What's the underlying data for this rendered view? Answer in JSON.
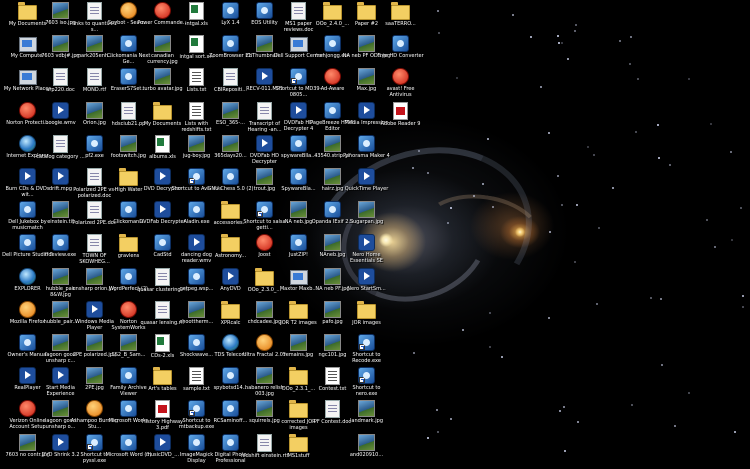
{
  "desktop": {
    "wallpaper": "galaxy",
    "icon_grid": {
      "columns": [
        {
          "icons": [
            {
              "label": "My Documents",
              "icon": "folder-icon"
            },
            {
              "label": "My Computer",
              "icon": "computer-icon"
            },
            {
              "label": "My Network Places",
              "icon": "network-icon"
            },
            {
              "label": "Norton Protecti...",
              "icon": "norton-icon"
            },
            {
              "label": "Internet Explorer",
              "icon": "ie-icon"
            },
            {
              "label": "Burn CDs & DVDs wit...",
              "icon": "cd-icon"
            },
            {
              "label": "Dell Jukebox by musicmatch",
              "icon": "jukebox-icon"
            },
            {
              "label": "Dell Picture Studio 3",
              "icon": "picture-studio-icon"
            },
            {
              "label": "EXPLORER",
              "icon": "explorer-icon"
            },
            {
              "label": "Mozilla Firefox",
              "icon": "firefox-icon"
            },
            {
              "label": "Owner's Manual",
              "icon": "manual-icon"
            },
            {
              "label": "RealPlayer",
              "icon": "realplayer-icon"
            },
            {
              "label": "Verizon Online Account Setup",
              "icon": "verizon-icon"
            },
            {
              "label": "7603 no contr.jpg",
              "icon": "jpg-file-icon"
            }
          ]
        },
        {
          "icons": [
            {
              "label": "7603 iso.jpg",
              "icon": "jpg-file-icon"
            },
            {
              "label": "7603 vdbj#.jpg",
              "icon": "jpg-file-icon"
            },
            {
              "label": "arp220.doc",
              "icon": "doc-file-icon"
            },
            {
              "label": "boogie.wmv",
              "icon": "video-file-icon"
            },
            {
              "label": "catalog category ...",
              "icon": "doc-file-icon"
            },
            {
              "label": "drift.mpg",
              "icon": "video-file-icon"
            },
            {
              "label": "einstein.tif",
              "icon": "image-file-icon"
            },
            {
              "label": "ffdeview.exe",
              "icon": "exe-file-icon"
            },
            {
              "label": "hubble_pair 8&W.jpg",
              "icon": "jpg-file-icon"
            },
            {
              "label": "hubble_pair...",
              "icon": "jpg-file-icon"
            },
            {
              "label": "lagoon good unsharp c...",
              "icon": "jpg-file-icon"
            },
            {
              "label": "Start Media Experience",
              "icon": "media-icon"
            },
            {
              "label": "lagoon good unsharp o...",
              "icon": "jpg-file-icon"
            },
            {
              "label": "DVD Shrink 3.2",
              "icon": "dvd-shrink-icon"
            }
          ]
        },
        {
          "icons": [
            {
              "label": "links to quantized s...",
              "icon": "doc-file-icon"
            },
            {
              "label": "mark205enh...",
              "icon": "jpg-file-icon"
            },
            {
              "label": "MOND.rtf",
              "icon": "doc-file-icon"
            },
            {
              "label": "Orion.jpg",
              "icon": "jpg-file-icon"
            },
            {
              "label": "pf2.exe",
              "icon": "exe-file-icon"
            },
            {
              "label": "Polarized 2PE vs-polarized.doc",
              "icon": "doc-file-icon"
            },
            {
              "label": "Polarized 2PE.doc",
              "icon": "doc-file-icon"
            },
            {
              "label": "TOWN OF SKOWHEG...",
              "icon": "doc-file-icon"
            },
            {
              "label": "unsharp orion.jpg",
              "icon": "jpg-file-icon"
            },
            {
              "label": "Windows Media Player",
              "icon": "wmp-icon"
            },
            {
              "label": "2PE polarized.jpg",
              "icon": "jpg-file-icon"
            },
            {
              "label": "2PE.jpg",
              "icon": "jpg-file-icon"
            },
            {
              "label": "Ashampoo Burning Stu...",
              "icon": "ashampoo-icon"
            },
            {
              "label": "Shortcut to pyssl.exe",
              "icon": "shortcut-icon"
            }
          ]
        },
        {
          "icons": [
            {
              "label": "Spybot - Searc...",
              "icon": "spybot-icon"
            },
            {
              "label": "Clickomania Next Ge...",
              "icon": "game-icon"
            },
            {
              "label": "EraserS7Set...",
              "icon": "exe-file-icon"
            },
            {
              "label": "hdsciub21.pp",
              "icon": "doc-file-icon"
            },
            {
              "label": "footswitch.jpg",
              "icon": "jpg-file-icon"
            },
            {
              "label": "High Water",
              "icon": "folder-icon"
            },
            {
              "label": "Clickomania",
              "icon": "game-icon"
            },
            {
              "label": "gravlens",
              "icon": "folder-icon"
            },
            {
              "label": "WordPerfect (2)",
              "icon": "wordperfect-icon"
            },
            {
              "label": "Norton SystemWorks",
              "icon": "norton-icon"
            },
            {
              "label": "SS2_B_Sam...",
              "icon": "jpg-file-icon"
            },
            {
              "label": "Family Archive Viewer",
              "icon": "app-icon"
            },
            {
              "label": "Microsoft Works",
              "icon": "works-icon"
            },
            {
              "label": "Microsoft Word (2)",
              "icon": "word-icon"
            }
          ]
        },
        {
          "icons": [
            {
              "label": "Power Commande...",
              "icon": "power-icon"
            },
            {
              "label": "canadian currency.jpg",
              "icon": "jpg-file-icon"
            },
            {
              "label": "turbo avatar.jpg",
              "icon": "jpg-file-icon"
            },
            {
              "label": "My Documents",
              "icon": "folder-icon"
            },
            {
              "label": "albums.xls",
              "icon": "xls-file-icon"
            },
            {
              "label": "DVD Decrypter",
              "icon": "dvd-icon"
            },
            {
              "label": "DVDFab Decrypter",
              "icon": "dvd-icon"
            },
            {
              "label": "CadStd",
              "icon": "app-icon"
            },
            {
              "label": "quasar clustering.rtf",
              "icon": "doc-file-icon"
            },
            {
              "label": "quasar lensing.rtf",
              "icon": "doc-file-icon"
            },
            {
              "label": "CDs-2.xls",
              "icon": "xls-file-icon"
            },
            {
              "label": "Art's tables",
              "icon": "folder-icon"
            },
            {
              "label": "History Highway 3.pdf",
              "icon": "pdf-file-icon"
            },
            {
              "label": "musicDVD_...",
              "icon": "media-icon"
            }
          ]
        },
        {
          "icons": [
            {
              "label": "intgal.xls",
              "icon": "xls-file-icon"
            },
            {
              "label": "intgal sort.xls",
              "icon": "xls-file-icon"
            },
            {
              "label": "Lists.txt",
              "icon": "txt-file-icon"
            },
            {
              "label": "Lists with redshifts.txt",
              "icon": "txt-file-icon"
            },
            {
              "label": "jug-boy.jpg",
              "icon": "jpg-file-icon"
            },
            {
              "label": "Shortcut to Avis.exe",
              "icon": "shortcut-icon"
            },
            {
              "label": "Aladin.exe",
              "icon": "exe-file-icon"
            },
            {
              "label": "dancing dog reader.wmv",
              "icon": "video-file-icon"
            },
            {
              "label": "getpeg.wsp...",
              "icon": "exe-file-icon"
            },
            {
              "label": "shoottherm...",
              "icon": "jpg-file-icon"
            },
            {
              "label": "Shockwave...",
              "icon": "app-icon"
            },
            {
              "label": "sample.txt",
              "icon": "txt-file-icon"
            },
            {
              "label": "Shortcut to mtbackup.exe",
              "icon": "shortcut-icon"
            },
            {
              "label": "ImageMagick Display",
              "icon": "imagemagick-icon"
            }
          ]
        },
        {
          "icons": [
            {
              "label": "LyX 1.4",
              "icon": "lyx-icon"
            },
            {
              "label": "ZoomBrowser EX",
              "icon": "camera-icon"
            },
            {
              "label": "CBIRepositi...",
              "icon": "doc-file-icon"
            },
            {
              "label": "ESO_365-...",
              "icon": "jpg-file-icon"
            },
            {
              "label": "365days20...",
              "icon": "jpg-file-icon"
            },
            {
              "label": "GNU Chess 5.0 (2)",
              "icon": "chess-icon"
            },
            {
              "label": "accessories...",
              "icon": "folder-icon"
            },
            {
              "label": "Astronomy...",
              "icon": "folder-icon"
            },
            {
              "label": "AnyDVD",
              "icon": "dvd-icon"
            },
            {
              "label": "XPRcalc",
              "icon": "folder-icon"
            },
            {
              "label": "TDS Telecom",
              "icon": "globe-icon"
            },
            {
              "label": "spybotsd14...",
              "icon": "exe-file-icon"
            },
            {
              "label": "RCSaminoff...",
              "icon": "exe-file-icon"
            },
            {
              "label": "Digital Photo Professional",
              "icon": "camera-icon"
            }
          ]
        },
        {
          "icons": [
            {
              "label": "EOS Utility",
              "icon": "camera-icon"
            },
            {
              "label": "ZbThumbnail...",
              "icon": "image-file-icon"
            },
            {
              "label": "RECV-011.MP3",
              "icon": "audio-file-icon"
            },
            {
              "label": "Transcript of Hearing -an...",
              "icon": "doc-file-icon"
            },
            {
              "label": "DVDFab HD Decrypter",
              "icon": "dvd-icon"
            },
            {
              "label": "trout.jpg",
              "icon": "jpg-file-icon"
            },
            {
              "label": "Shortcut to salsa getti...",
              "icon": "shortcut-icon"
            },
            {
              "label": "Joost",
              "icon": "joost-icon"
            },
            {
              "label": "OOo_2.3.0_...",
              "icon": "folder-icon"
            },
            {
              "label": "chdcadee.jpg",
              "icon": "jpg-file-icon"
            },
            {
              "label": "Ultra Fractal 2.05",
              "icon": "fractal-icon"
            },
            {
              "label": "habanero relish 003.jpg",
              "icon": "jpg-file-icon"
            },
            {
              "label": "squirrels.jpg",
              "icon": "jpg-file-icon"
            },
            {
              "label": "redshift einstein.rtf",
              "icon": "doc-file-icon"
            }
          ]
        },
        {
          "icons": [
            {
              "label": "MS1 paper reviews.doc",
              "icon": "doc-file-icon"
            },
            {
              "label": "Dell Support Center",
              "icon": "dell-icon"
            },
            {
              "label": "Shortcut to MD39-0805...",
              "icon": "shortcut-icon"
            },
            {
              "label": "DVDFab HD Decrypter 4",
              "icon": "dvd-icon"
            },
            {
              "label": "spywareBlla...",
              "icon": "exe-file-icon"
            },
            {
              "label": "SpywareBla...",
              "icon": "exe-file-icon"
            },
            {
              "label": "NA neb.jpg",
              "icon": "jpg-file-icon"
            },
            {
              "label": "JustZIP!",
              "icon": "zip-icon"
            },
            {
              "label": "Maxtor Maxb...",
              "icon": "maxtor-icon"
            },
            {
              "label": "JOR T2 images",
              "icon": "folder-icon"
            },
            {
              "label": "remains.jpg",
              "icon": "jpg-file-icon"
            },
            {
              "label": "OOo_2.3.1_...",
              "icon": "folder-icon"
            },
            {
              "label": "corrected JOR images",
              "icon": "folder-icon"
            },
            {
              "label": "MS1stuff",
              "icon": "folder-icon"
            }
          ]
        },
        {
          "icons": [
            {
              "label": "OOo_2.4.0_...",
              "icon": "folder-icon"
            },
            {
              "label": "mahjongg.exe",
              "icon": "exe-file-icon"
            },
            {
              "label": "Ad-Aware",
              "icon": "adaware-icon"
            },
            {
              "label": "PageBreeze HTML Editor",
              "icon": "app-icon"
            },
            {
              "label": "43540.strip.gif",
              "icon": "image-file-icon"
            },
            {
              "label": "hairz.jpg",
              "icon": "jpg-file-icon"
            },
            {
              "label": "Opanda IExif 2.3",
              "icon": "exif-icon"
            },
            {
              "label": "NAneb.jpg",
              "icon": "jpg-file-icon"
            },
            {
              "label": "NA neb PF.jpg",
              "icon": "jpg-file-icon"
            },
            {
              "label": "pafo.jpg",
              "icon": "jpg-file-icon"
            },
            {
              "label": "ngc101.jpg",
              "icon": "jpg-file-icon"
            },
            {
              "label": "Contest.txt",
              "icon": "txt-file-icon"
            },
            {
              "label": "PF Contest.doc",
              "icon": "doc-file-icon"
            }
          ]
        },
        {
          "icons": [
            {
              "label": "Paper #2",
              "icon": "folder-icon"
            },
            {
              "label": "NA neb PF ODS.jpg",
              "icon": "jpg-file-icon"
            },
            {
              "label": "Max.jpg",
              "icon": "jpg-file-icon"
            },
            {
              "label": "Media Impression",
              "icon": "media-icon"
            },
            {
              "label": "Panorama Maker 4",
              "icon": "app-icon"
            },
            {
              "label": "QuickTime Player",
              "icon": "quicktime-icon"
            },
            {
              "label": "Sugarpan.jpg",
              "icon": "jpg-file-icon"
            },
            {
              "label": "Nero Home Essentials SE",
              "icon": "nero-icon"
            },
            {
              "label": "Nero StartSm...",
              "icon": "nero-icon"
            },
            {
              "label": "JOR images",
              "icon": "folder-icon"
            },
            {
              "label": "Shortcut to Recode.exe",
              "icon": "shortcut-icon"
            },
            {
              "label": "Shortcut to nero.exe",
              "icon": "shortcut-icon"
            },
            {
              "label": "landmark.jpg",
              "icon": "jpg-file-icon"
            },
            {
              "label": "and020910...",
              "icon": "jpg-file-icon"
            }
          ]
        },
        {
          "icons": [
            {
              "label": "saaTERRO...",
              "icon": "folder-icon"
            },
            {
              "label": "Free HD Converter",
              "icon": "app-icon"
            },
            {
              "label": "avast! Free Antivirus",
              "icon": "avast-icon"
            },
            {
              "label": "Adobe Reader 9",
              "icon": "adobe-reader-icon"
            }
          ]
        }
      ]
    }
  }
}
